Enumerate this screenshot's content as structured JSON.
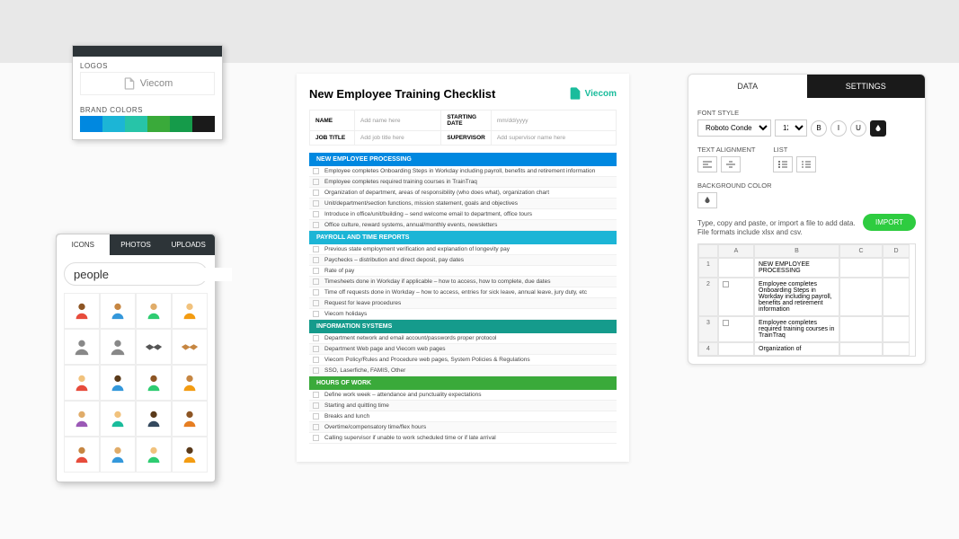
{
  "logosPanel": {
    "logosLabel": "LOGOS",
    "logoText": "Viecom",
    "brandLabel": "BRAND COLORS",
    "colors": [
      "#0088e0",
      "#1cb5d6",
      "#27c4a8",
      "#3aaa3a",
      "#159b4a",
      "#1a1a1a"
    ]
  },
  "iconsPanel": {
    "tabs": [
      "ICONS",
      "PHOTOS",
      "UPLOADS"
    ],
    "searchValue": "people"
  },
  "doc": {
    "title": "New Employee Training Checklist",
    "logoText": "Viecom",
    "meta": {
      "nameLabel": "NAME",
      "namePlaceholder": "Add name here",
      "jobLabel": "JOB TITLE",
      "jobPlaceholder": "Add job title here",
      "startLabel": "STARTING DATE",
      "startPlaceholder": "mm/dd/yyyy",
      "supLabel": "SUPERVISOR",
      "supPlaceholder": "Add supervisor name here"
    },
    "sections": [
      {
        "color": "blue",
        "title": "NEW EMPLOYEE PROCESSING",
        "items": [
          "Employee completes Onboarding Steps in Workday including payroll, benefits and retirement information",
          "Employee completes required training courses in TrainTraq",
          "Organization of department, areas of responsibility (who does what), organization chart",
          "Unit/department/section functions, mission statement, goals and objectives",
          "Introduce in office/unit/building – send welcome email to department, office tours",
          "Office culture, reward systems, annual/monthly events, newsletters"
        ]
      },
      {
        "color": "cyan",
        "title": "PAYROLL AND TIME REPORTS",
        "items": [
          "Previous state employment verification and explanation of longevity pay",
          "Paychecks – distribution and direct deposit, pay dates",
          "Rate of pay",
          "Timesheets done in Workday if applicable – how to access, how to complete, due dates",
          "Time off requests done in Workday – how to access, entries for sick leave, annual leave, jury duty, etc",
          "Request for leave procedures",
          "Viecom holidays"
        ]
      },
      {
        "color": "teal",
        "title": "INFORMATION SYSTEMS",
        "items": [
          "Department network and email account/passwords proper protocol",
          "Department Web page and Viecom web pages",
          "Viecom Policy/Rules and Procedure web pages, System Policies & Regulations",
          "SSO, Laserfiche, FAMIS, Other"
        ]
      },
      {
        "color": "green",
        "title": "HOURS OF WORK",
        "items": [
          "Define work week – attendance and punctuality expectations",
          "Starting and quitting time",
          "Breaks and lunch",
          "Overtime/compensatory time/flex hours",
          "Calling supervisor if unable to work scheduled time or if late arrival"
        ]
      }
    ]
  },
  "rightPanel": {
    "tabs": {
      "data": "DATA",
      "settings": "SETTINGS"
    },
    "fontStyleLabel": "FONT STYLE",
    "fontFamily": "Roboto Condensed",
    "fontSize": "12",
    "bold": "B",
    "italic": "I",
    "underline": "U",
    "textAlignLabel": "TEXT ALIGNMENT",
    "listLabel": "LIST",
    "bgLabel": "BACKGROUND COLOR",
    "helpText": "Type, copy and paste, or import a file to add data. File formats include xlsx and csv.",
    "importLabel": "IMPORT",
    "cols": [
      "A",
      "B",
      "C",
      "D"
    ],
    "rows": [
      {
        "n": "1",
        "a": "",
        "b": "NEW EMPLOYEE PROCESSING",
        "c": "",
        "d": ""
      },
      {
        "n": "2",
        "a": "cb",
        "b": "Employee completes Onboarding Steps in Workday including payroll, benefits and retirement information",
        "c": "",
        "d": ""
      },
      {
        "n": "3",
        "a": "cb",
        "b": "Employee completes required training courses in TrainTraq",
        "c": "",
        "d": ""
      },
      {
        "n": "4",
        "a": "",
        "b": "Organization of",
        "c": "",
        "d": ""
      }
    ]
  }
}
